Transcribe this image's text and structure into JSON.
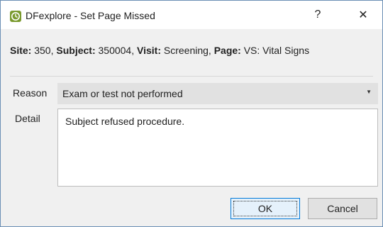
{
  "window": {
    "title": "DFexplore - Set Page Missed",
    "help_glyph": "?",
    "close_glyph": "✕"
  },
  "info": {
    "site_label": "Site:",
    "site_value": "350",
    "subject_label": "Subject:",
    "subject_value": "350004",
    "visit_label": "Visit:",
    "visit_value": "Screening",
    "page_label": "Page:",
    "page_value": "VS: Vital Signs"
  },
  "form": {
    "reason_label": "Reason",
    "reason_value": "Exam or test not performed",
    "reason_arrow": "▼",
    "detail_label": "Detail",
    "detail_value": "Subject refused procedure."
  },
  "buttons": {
    "ok_label": "OK",
    "cancel_label": "Cancel"
  },
  "colors": {
    "accent": "#0078d7",
    "app_icon": "#7a9a2e"
  }
}
